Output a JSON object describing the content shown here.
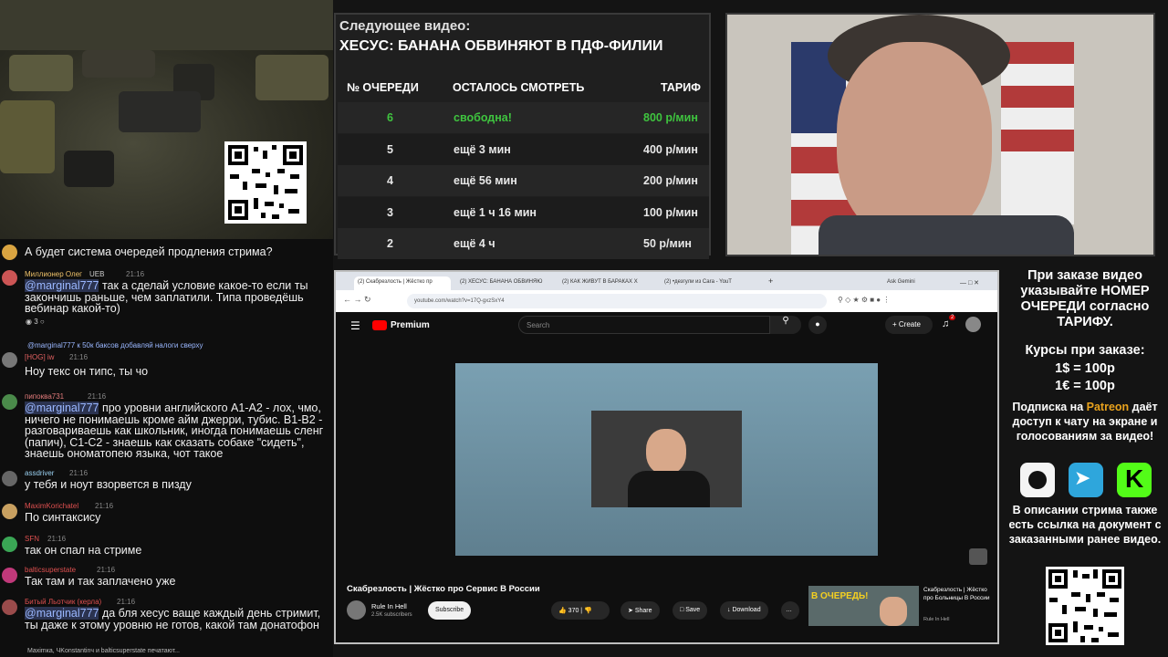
{
  "queue": {
    "title": "Следующее видео:",
    "video": "ХЕСУС: БАНАНА ОБВИНЯЮТ В ПДФ-ФИЛИИ",
    "headers": [
      "№ ОЧЕРЕДИ",
      "ОСТАЛОСЬ СМОТРЕТЬ",
      "ТАРИФ"
    ],
    "rows": [
      {
        "num": "6",
        "left": "свободна!",
        "tariff": "800 р/мин"
      },
      {
        "num": "5",
        "left": "ещё 3 мин",
        "tariff": "400 р/мин"
      },
      {
        "num": "4",
        "left": "ещё 56 мин",
        "tariff": "200 р/мин"
      },
      {
        "num": "3",
        "left": "ещё 1 ч 16 мин",
        "tariff": "100 р/мин"
      },
      {
        "num": "2",
        "left": "ещё 4 ч",
        "tariff": "50 р/мин"
      }
    ],
    "free_color": "#3fc43f"
  },
  "chat": {
    "messages": [
      {
        "name": "",
        "time": "",
        "text": "А будет система очередей продления стрима?"
      },
      {
        "name": "Миллионер Олег",
        "badge": "UEB",
        "time": "21:16",
        "mention": "@marginal777",
        "text": " так а сделай условие какое-то если ты закончишь раньше, чем заплатили. Типа проведёшь вебинар какой-то)",
        "reactions": "3"
      },
      {
        "name": "[HOG] iw",
        "reply": "@marginal777 к 50к баксов добавляй налоги сверху",
        "time": "21:16",
        "text": "Ноу текс он типс, ты чо"
      },
      {
        "name": "пипоквa731",
        "time": "21:16",
        "mention": "@marginal777",
        "text": " про уровни английского А1-А2 - лох, чмо, ничего не понимаешь кроме айм джерри, тубис. В1-В2 - разговариваешь как школьник, иногда понимаешь сленг (папич), С1-С2  - знаешь как сказать собаке \"сидеть\", знаешь ономатопею языка, чот такое"
      },
      {
        "name": "assdriver",
        "time": "21:16",
        "text": "у тебя и ноут взорвется в пизду"
      },
      {
        "name": "MaximKorichatel",
        "time": "21:16",
        "text": "По синтаксису"
      },
      {
        "name": "SFN",
        "time": "21:16",
        "text": "так он спал на стриме"
      },
      {
        "name": "balticsuperstate",
        "time": "21:16",
        "text": "Так там и так заплачено уже"
      },
      {
        "name": "Битый Льотчик (керла)",
        "time": "21:16",
        "mention": "@marginal777",
        "text": " да бля хесус ваще каждый день стримит, ты даже к этому уровню не готов, какой там донатофон"
      }
    ],
    "typing": "Maximка, ЧKonstantinч и balticsuperstate печатают..."
  },
  "browser": {
    "tabs": [
      "(2) Скабрезлость | Жёстко пр",
      "(2) ХЕСУС: БАНАНА ОБВИНЯЮ",
      "(2) КАК ЖИВУТ В БАРАКАХ Х",
      "(2) •дезгули из Cara - YouT"
    ],
    "new_tab": "+",
    "ask": "Ask Gemini",
    "url": "youtube.com/watch?v=17Q-gxzSxY4"
  },
  "youtube": {
    "brand": "Premium",
    "search_placeholder": "Search",
    "create": "Create",
    "notif_count": "2",
    "video_title": "Скабрезлость | Жёстко про Сервис В России",
    "channel": "Rule In Hell",
    "subscribers": "2.5K subscribers",
    "subscribe": "Subscribe",
    "likes": "370",
    "share": "Share",
    "save": "Save",
    "download": "Download",
    "rec_thumb_text": "В ОЧЕРЕДЬ!",
    "rec_title": "Скабрезлость | Жёстко про Больницы В России",
    "rec_channel": "Rule In Hell"
  },
  "info": {
    "p1": "При заказе видео указывайте НОМЕР ОЧЕРЕДИ согласно ТАРИФУ.",
    "p2": "Курсы при заказе:",
    "rate1": "1$ = 100р",
    "rate2": "1€ = 100р",
    "p3a": "Подписка на ",
    "patreon": "Patreon",
    "p3b": " даёт доступ к чату на экране и голосованиям за видео!",
    "p4": "В описании стрима также есть ссылка на документ с заказанными ранее видео.",
    "patreon_color": "#e8a21d"
  }
}
